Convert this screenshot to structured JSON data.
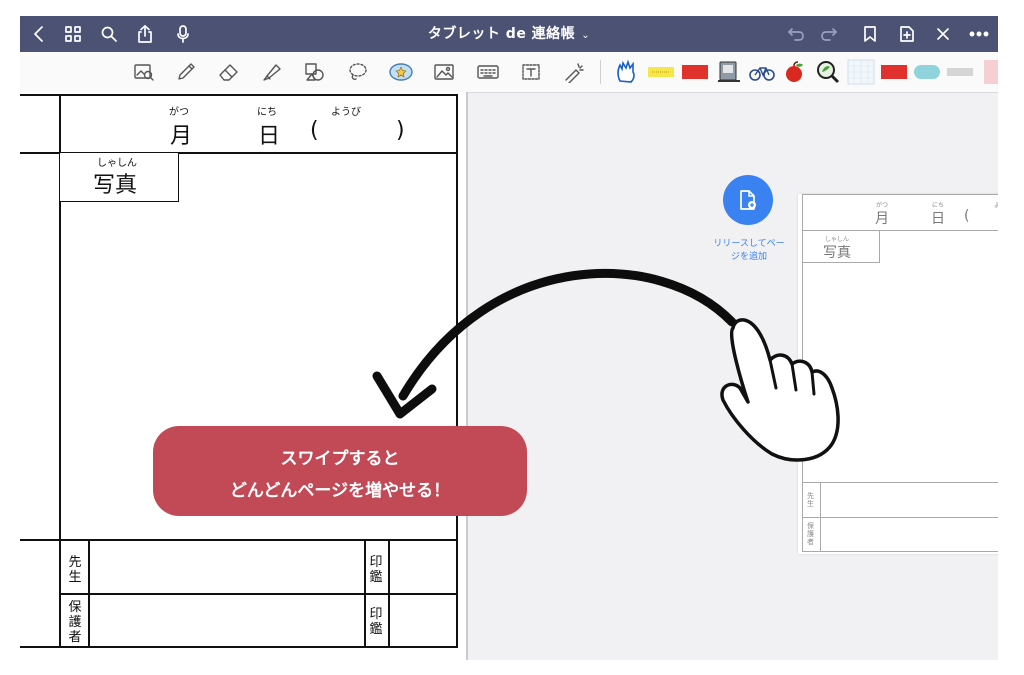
{
  "topbar": {
    "title": "タブレット de 連絡帳",
    "title_chevron": "⌄",
    "left_icons": [
      "back-chevron-icon",
      "grid-icon",
      "search-icon",
      "share-icon",
      "microphone-icon"
    ],
    "right_icons": [
      "undo-icon",
      "redo-icon",
      "bookmark-icon",
      "add-page-icon",
      "close-icon",
      "more-icon"
    ]
  },
  "toolbar": {
    "tools": [
      "image-search-icon",
      "pen-icon",
      "eraser-icon",
      "highlighter-icon",
      "shapes-icon",
      "lasso-icon",
      "sticker-icon",
      "image-icon",
      "keyboard-icon",
      "text-box-icon",
      "laser-pointer-icon"
    ],
    "stickers": [
      "hand-sticker",
      "yellow-label-sticker",
      "red-tape-sticker",
      "notebook-sticker",
      "bicycle-sticker",
      "apple-sticker",
      "magnifier-sticker",
      "grid-sticker",
      "red-block-sticker",
      "teal-pill-sticker",
      "gray-bar-sticker",
      "pink-bar-sticker"
    ]
  },
  "left_page": {
    "month_ruby": "がつ",
    "month": "月",
    "day_ruby": "にち",
    "day": "日",
    "weekday_ruby": "ようび",
    "paren_open": "(",
    "paren_close": ")",
    "photo_ruby": "しゃしん",
    "photo": "写真",
    "teacher": "先生",
    "guardian": "保護者",
    "seal": "印鑑"
  },
  "right_page": {
    "month_ruby": "がつ",
    "month": "月",
    "day_ruby": "にち",
    "day": "日",
    "paren_open": "(",
    "weekday_ruby_partial": "よう",
    "photo_ruby": "しゃしん",
    "photo": "写真",
    "teacher": "先生",
    "guardian": "保護者"
  },
  "release": {
    "label": "リリースしてページを追加",
    "color": "#3a82f2"
  },
  "hint": {
    "line1": "スワイプすると",
    "line2": "どんどんページを増やせる！",
    "color": "#c24a57"
  },
  "colors": {
    "topbar_bg": "#4b5274",
    "canvas_bg": "#f1f1f3"
  }
}
